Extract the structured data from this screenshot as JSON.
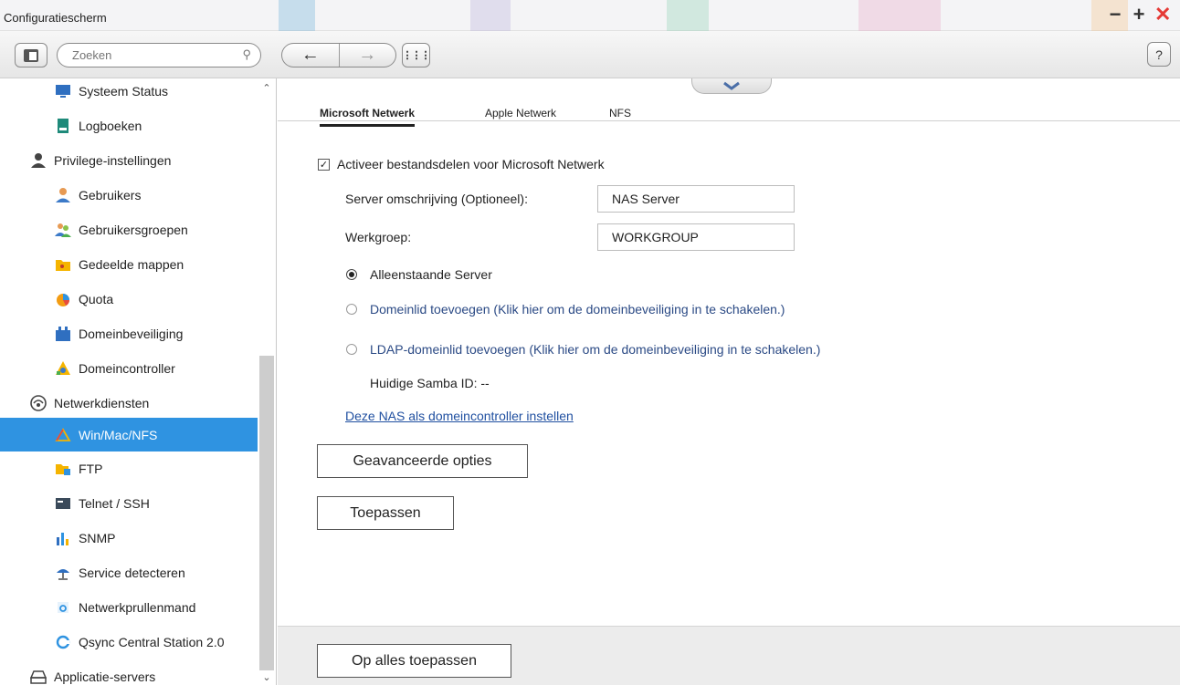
{
  "window": {
    "title": "Configuratiescherm",
    "controls": [
      "−",
      "+",
      "✕"
    ]
  },
  "toolbar": {
    "search_placeholder": "Zoeken",
    "back": "←",
    "forward": "→",
    "apps": "⋮⋮⋮",
    "help": "?"
  },
  "sidebar": {
    "items": [
      {
        "label": "Systeem Status",
        "icon": "monitor-icon",
        "level": 2
      },
      {
        "label": "Logboeken",
        "icon": "log-icon",
        "level": 2
      },
      {
        "label": "Privilege-instellingen",
        "icon": "user-icon",
        "level": 1
      },
      {
        "label": "Gebruikers",
        "icon": "user-icon",
        "level": 2
      },
      {
        "label": "Gebruikersgroepen",
        "icon": "group-icon",
        "level": 2
      },
      {
        "label": "Gedeelde mappen",
        "icon": "folder-icon",
        "level": 2
      },
      {
        "label": "Quota",
        "icon": "pie-icon",
        "level": 2
      },
      {
        "label": "Domeinbeveiliging",
        "icon": "domain-icon",
        "level": 2
      },
      {
        "label": "Domeincontroller",
        "icon": "controller-icon",
        "level": 2
      },
      {
        "label": "Netwerkdiensten",
        "icon": "network-icon",
        "level": 1
      },
      {
        "label": "Win/Mac/NFS",
        "icon": "triangle-icon",
        "level": 2,
        "active": true
      },
      {
        "label": "FTP",
        "icon": "ftp-icon",
        "level": 2
      },
      {
        "label": "Telnet / SSH",
        "icon": "terminal-icon",
        "level": 2
      },
      {
        "label": "SNMP",
        "icon": "bars-icon",
        "level": 2
      },
      {
        "label": "Service detecteren",
        "icon": "satellite-icon",
        "level": 2
      },
      {
        "label": "Netwerkprullenmand",
        "icon": "recycle-icon",
        "level": 2
      },
      {
        "label": "Qsync Central Station 2.0",
        "icon": "sync-icon",
        "level": 2
      },
      {
        "label": "Applicatie-servers",
        "icon": "server-icon",
        "level": 1
      }
    ]
  },
  "tabs": [
    {
      "label": "Microsoft Netwerk",
      "active": true
    },
    {
      "label": "Apple Netwerk",
      "active": false
    },
    {
      "label": "NFS",
      "active": false
    }
  ],
  "form": {
    "enable_label": "Activeer bestandsdelen voor Microsoft Netwerk",
    "enable_checked": true,
    "server_desc_label": "Server omschrijving (Optioneel):",
    "server_desc_value": "NAS Server",
    "workgroup_label": "Werkgroep:",
    "workgroup_value": "WORKGROUP",
    "radios": [
      {
        "label": "Alleenstaande Server",
        "selected": true
      },
      {
        "label": "Domeinlid toevoegen (Klik hier om de domeinbeveiliging in te schakelen.)",
        "selected": false
      },
      {
        "label": "LDAP-domeinlid toevoegen (Klik hier om de domeinbeveiliging in te schakelen.)",
        "selected": false
      }
    ],
    "samba_id": "Huidige Samba ID: --",
    "dc_link": "Deze NAS als domeincontroller instellen",
    "advanced_button": "Geavanceerde opties",
    "apply_button": "Toepassen",
    "apply_all_button": "Op alles toepassen"
  },
  "colors": {
    "accent": "#2f93e1",
    "close": "#e53935",
    "link": "#1f4fa0"
  }
}
